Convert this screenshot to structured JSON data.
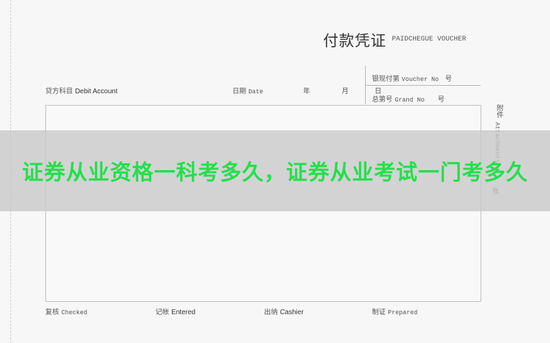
{
  "voucher": {
    "title_cn": "付款凭证",
    "title_en": "PAIDCHEGUE VOUCHER",
    "debit_account_cn": "贷方科目",
    "debit_account_en": "Debit Account",
    "date_cn": "日期",
    "date_en": "Date",
    "year": "年",
    "month": "月",
    "day": "日",
    "voucher_no_cn": "银现付第",
    "voucher_no_en": "Voucher No",
    "number_mark": "号",
    "grand_no_cn": "总第号",
    "grand_no_en": "Grand No",
    "grand_number_mark": "号",
    "attachment_cn": "附件",
    "attachment_en": "Attachments",
    "attachment_unit": "张",
    "checked_cn": "复核",
    "checked_en": "Checked",
    "entered_cn": "记帐",
    "entered_en": "Entered",
    "cashier_cn": "出纳",
    "cashier_en": "Cashier",
    "prepared_cn": "制证",
    "prepared_en": "Prepared"
  },
  "banner": {
    "text": "证券从业资格一科考多久，证券从业考试一门考多久",
    "color": "#22e04a"
  }
}
